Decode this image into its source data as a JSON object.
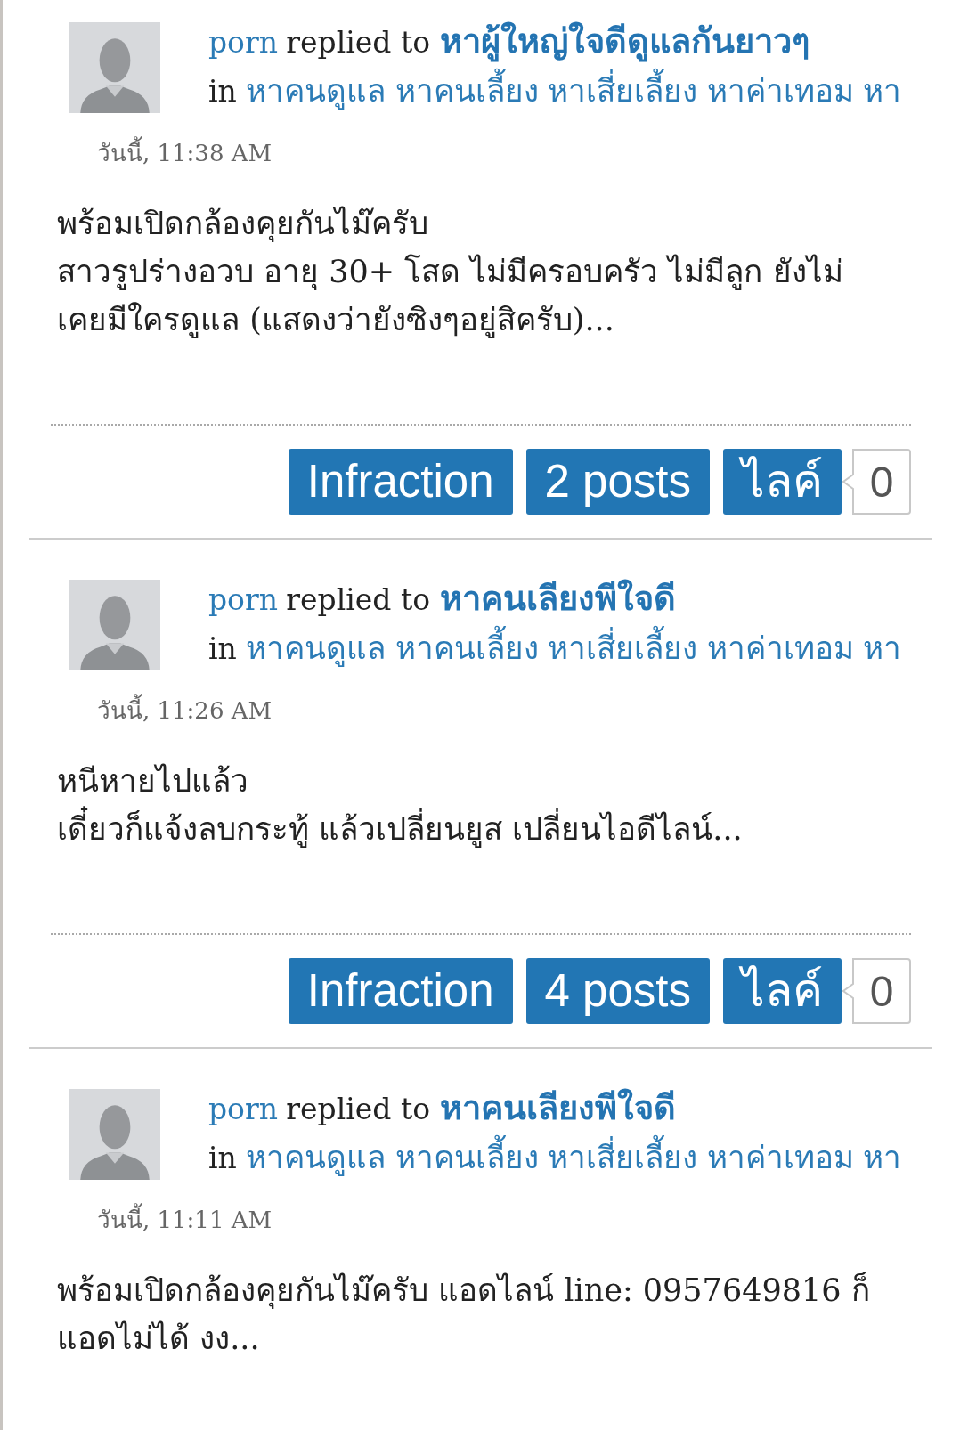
{
  "entries": [
    {
      "user": "porn",
      "action": "replied to",
      "thread": "หาผู้ใหญ่ใจดีดูแลกันยาวๆ",
      "in_label": "in",
      "tags": [
        "หาคนดูแล",
        "หาคนเลี้ยง",
        "หาเสี่ยเลี้ยง",
        "หาค่าเทอม",
        "หา"
      ],
      "date": "วันนี้, 11:38 AM",
      "body": [
        "พร้อมเปิดกล้องคุยกันไม๊ครับ",
        "สาวรูปร่างอวบ อายุ 30+ โสด ไม่มีครอบครัว ไม่มีลูก ยังไม่",
        "เคยมีใครดูแล (แสดงว่ายังซิงๆอยู่สิครับ)..."
      ],
      "footer": {
        "buttons": [
          "Infraction",
          "2 posts",
          "ไลค์"
        ],
        "like_count": "0"
      }
    },
    {
      "user": "porn",
      "action": "replied to",
      "thread": "หาคนเลียงพีใจดี",
      "in_label": "in",
      "tags": [
        "หาคนดูแล",
        "หาคนเลี้ยง",
        "หาเสี่ยเลี้ยง",
        "หาค่าเทอม",
        "หา"
      ],
      "date": "วันนี้, 11:26 AM",
      "body": [
        "หนีหายไปแล้ว",
        "เดี๋ยวก็แจ้งลบกระทู้ แล้วเปลี่ยนยูส เปลี่ยนไอดีไลน์..."
      ],
      "footer": {
        "buttons": [
          "Infraction",
          "4 posts",
          "ไลค์"
        ],
        "like_count": "0"
      }
    },
    {
      "user": "porn",
      "action": "replied to",
      "thread": "หาคนเลียงพีใจดี",
      "in_label": "in",
      "tags": [
        "หาคนดูแล",
        "หาคนเลี้ยง",
        "หาเสี่ยเลี้ยง",
        "หาค่าเทอม",
        "หา"
      ],
      "date": "วันนี้, 11:11 AM",
      "body": [
        "พร้อมเปิดกล้องคุยกันไม๊ครับ แอดไลน์ line: 0957649816 ก็",
        "แอดไม่ได้ งง..."
      ]
    }
  ]
}
